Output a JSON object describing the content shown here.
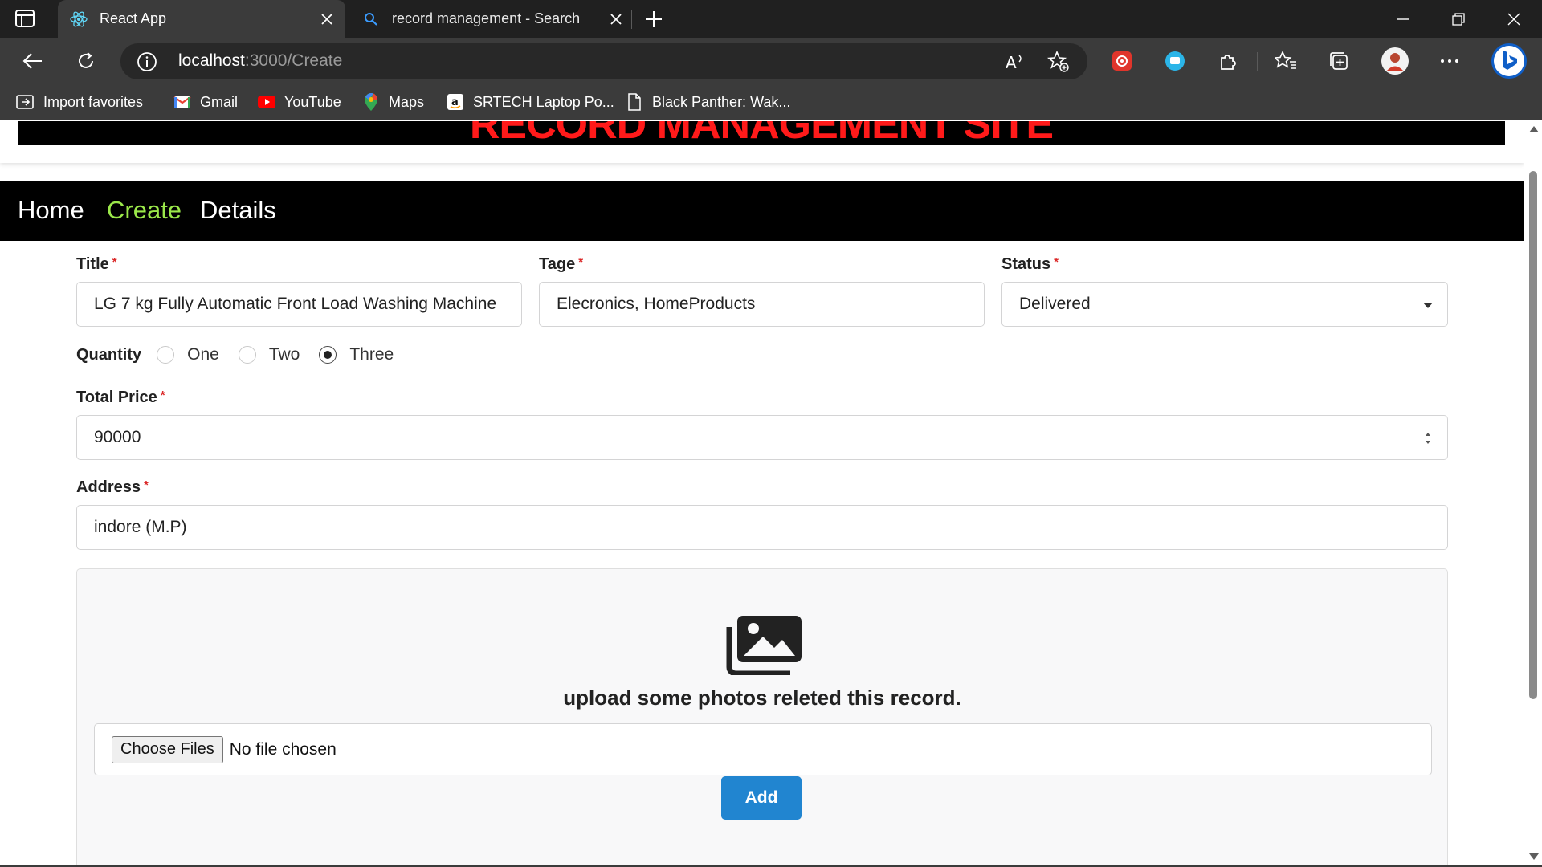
{
  "browser": {
    "tabs": [
      {
        "label": "React App",
        "icon": "react-icon",
        "active": true
      },
      {
        "label": "record management - Search",
        "icon": "search-icon",
        "active": false
      }
    ],
    "address": {
      "host": "localhost",
      "path": ":3000/Create"
    },
    "bookmarks": [
      {
        "label": "Import favorites",
        "icon": "import-favorites-icon"
      },
      {
        "label": "Gmail",
        "icon": "gmail-icon"
      },
      {
        "label": "YouTube",
        "icon": "youtube-icon"
      },
      {
        "label": "Maps",
        "icon": "maps-pin-icon"
      },
      {
        "label": "SRTECH Laptop Po...",
        "icon": "amazon-icon"
      },
      {
        "label": "Black Panther: Wak...",
        "icon": "page-icon"
      }
    ]
  },
  "site": {
    "title": "RECORD MANAGEMENT SITE",
    "nav": [
      {
        "label": "Home",
        "active": false
      },
      {
        "label": "Create",
        "active": true
      },
      {
        "label": "Details",
        "active": false
      }
    ]
  },
  "form": {
    "title_label": "Title",
    "title_value": "LG 7 kg Fully Automatic Front Load Washing Machine",
    "tage_label": "Tage",
    "tage_value": "Elecronics, HomeProducts",
    "status_label": "Status",
    "status_value": "Delivered",
    "quantity_label": "Quantity",
    "quantity_options": [
      "One",
      "Two",
      "Three"
    ],
    "quantity_selected": "Three",
    "price_label": "Total Price",
    "price_value": "90000",
    "address_label": "Address",
    "address_value": "indore (M.P)",
    "required_mark": "*",
    "upload_text": "upload some photos releted this record.",
    "file_button": "Choose Files",
    "file_status": "No file chosen",
    "add_button": "Add"
  },
  "colors": {
    "site_title": "#ff1a1a",
    "nav_active": "#9be84a",
    "add_button": "#2185d0",
    "required": "#db2828"
  }
}
